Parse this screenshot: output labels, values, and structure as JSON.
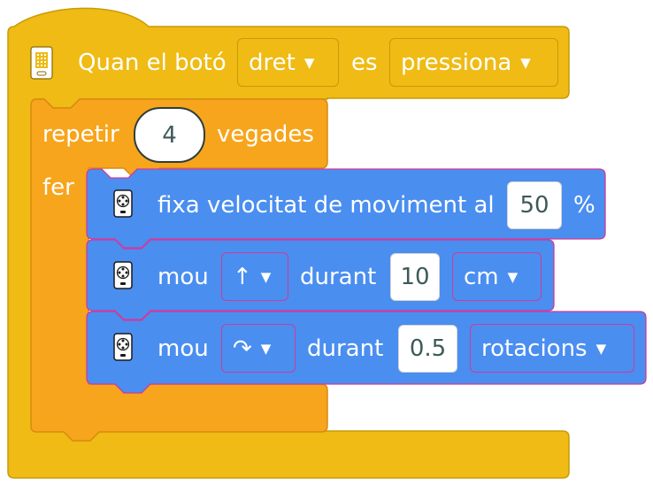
{
  "event_block": {
    "prefix": "Quan el botó",
    "button_value": "dret",
    "es_label": "es",
    "state_value": "pressiona",
    "hub_icon": "hub-icon"
  },
  "repeat_block": {
    "repeat_label": "repetir",
    "count": "4",
    "times_label": "vegades",
    "do_label": "fer"
  },
  "set_speed_block": {
    "label": "fixa velocitat de moviment al",
    "value": "50",
    "unit": "%",
    "icon": "remote-icon"
  },
  "move_block_1": {
    "label": "mou",
    "direction": "↑",
    "during_label": "durant",
    "amount": "10",
    "unit": "cm",
    "icon": "remote-icon"
  },
  "move_block_2": {
    "label": "mou",
    "direction": "↷",
    "during_label": "durant",
    "amount": "0.5",
    "unit": "rotacions",
    "icon": "remote-icon"
  },
  "colors": {
    "event": "#efbb14",
    "control": "#f7a51c",
    "motion": "#4a8ef0",
    "dropdown_border_motion": "#d03a9a"
  }
}
